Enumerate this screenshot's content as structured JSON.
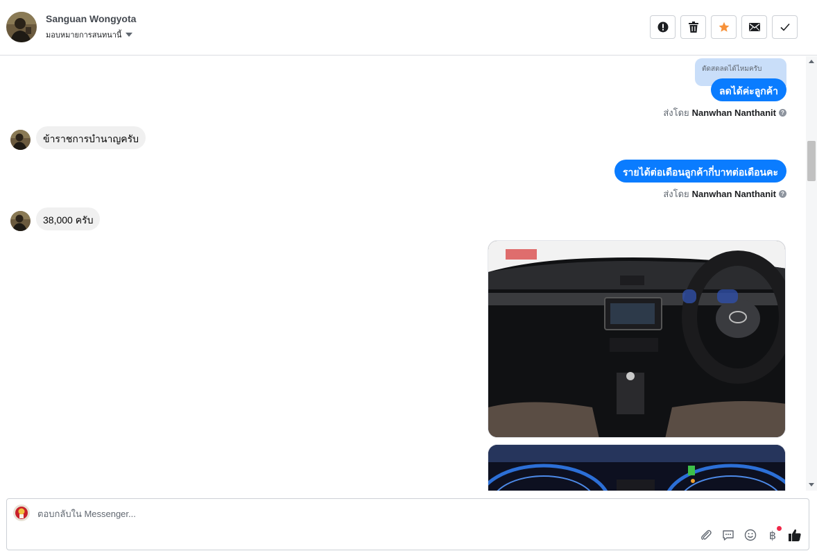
{
  "header": {
    "contact_name": "Sanguan Wongyota",
    "assign_label": "มอบหมายการสนทนานี้"
  },
  "messages": {
    "quoted_reply": "ตัดสดลดได้ไหมครับ",
    "out_1": "ลดได้ค่ะลูกค้า",
    "sender_1_prefix": "ส่งโดย",
    "sender_1_name": "Nanwhan Nanthanit",
    "in_1": "ข้าราชการบำนาญครับ",
    "out_2": "รายได้ต่อเดือนลูกค้ากี่บาทต่อเดือนคะ",
    "sender_2_prefix": "ส่งโดย",
    "sender_2_name": "Nanwhan Nanthanit",
    "in_2": "38,000 ครับ"
  },
  "composer": {
    "placeholder": "ตอบกลับใน Messenger...",
    "currency_symbol": "฿"
  },
  "colors": {
    "outgoing_bubble": "#0a7cff",
    "incoming_bubble": "#f0f0f0",
    "star": "#f7923a",
    "notification_dot": "#f02849"
  }
}
